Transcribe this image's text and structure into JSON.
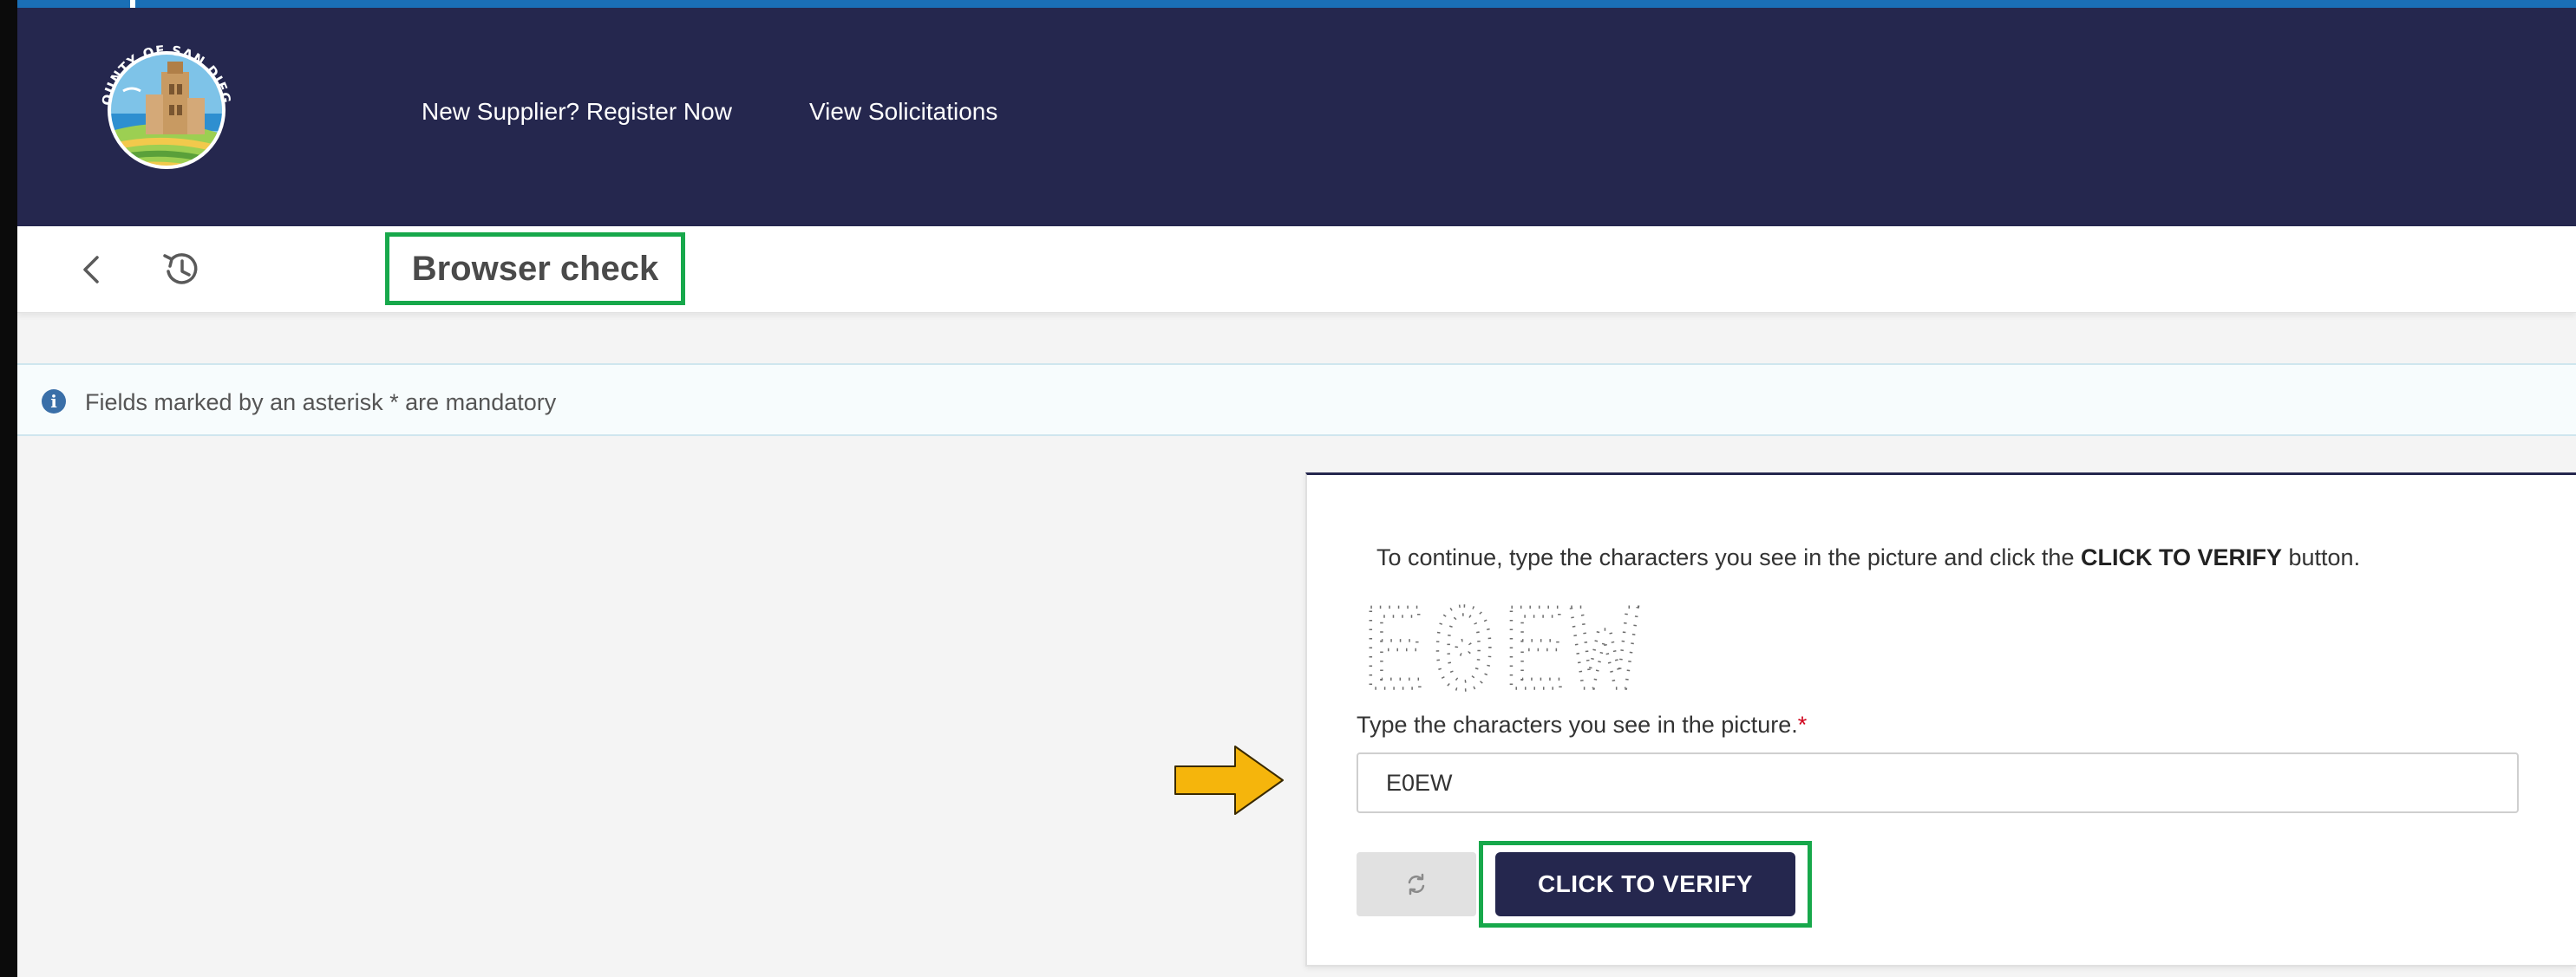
{
  "nav": {
    "register_label": "New Supplier? Register Now",
    "solicitations_label": "View Solicitations"
  },
  "toolbar": {
    "page_title": "Browser check",
    "back_icon": "chevron-left-icon",
    "history_icon": "history-icon"
  },
  "info": {
    "text": "Fields marked by an asterisk * are mandatory",
    "icon": "info-icon"
  },
  "captcha": {
    "instructions_before": "To continue, type the characters you see in the picture and click the ",
    "instructions_bold": "CLICK TO VERIFY",
    "instructions_after": " button.",
    "image_text": "E0EW",
    "field_label": "Type the characters you see in the picture.",
    "required_marker": "*",
    "input_value": "E0EW",
    "refresh_icon": "refresh-icon",
    "verify_label": "CLICK TO VERIFY"
  },
  "colors": {
    "header_bg": "#25274e",
    "highlight": "#17a84b",
    "arrow": "#f5b50c",
    "frame_accent": "#1a6fb6"
  }
}
